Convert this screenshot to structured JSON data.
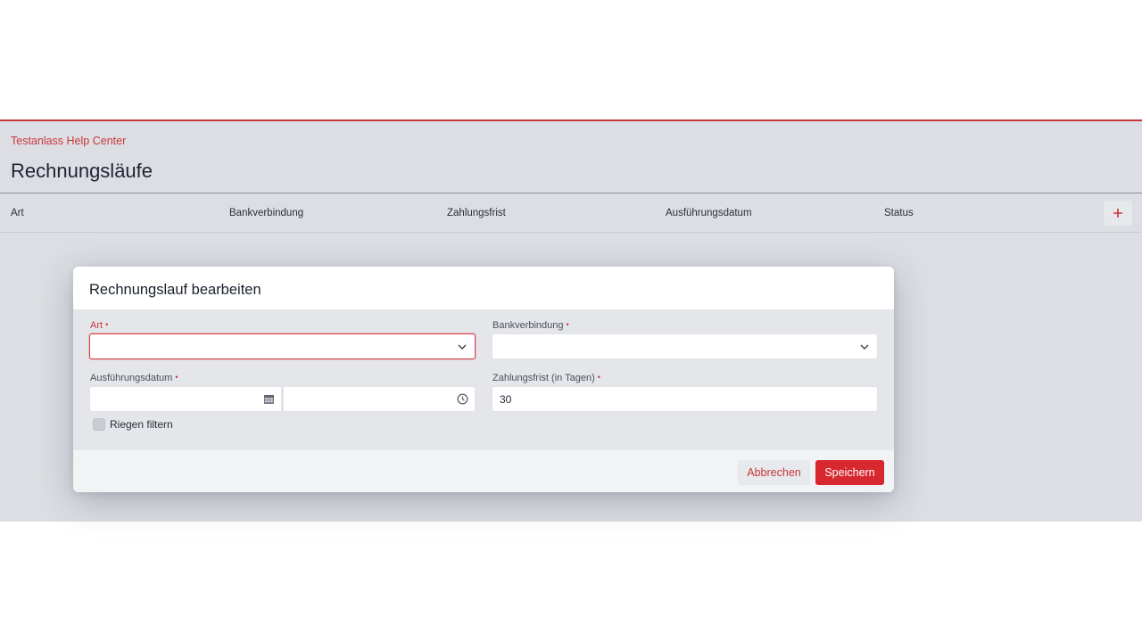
{
  "breadcrumb": "Testanlass Help Center",
  "page_title": "Rechnungsläufe",
  "table": {
    "columns": [
      "Art",
      "Bankverbindung",
      "Zahlungsfrist",
      "Ausführungsdatum",
      "Status"
    ],
    "add_icon": "plus-icon"
  },
  "modal": {
    "title": "Rechnungslauf bearbeiten",
    "fields": {
      "art": {
        "label": "Art",
        "required": "•",
        "value": ""
      },
      "bankverbindung": {
        "label": "Bankverbindung",
        "required": "•",
        "value": ""
      },
      "ausfuehrungsdatum": {
        "label": "Ausführungsdatum",
        "required": "•",
        "date_value": "",
        "time_value": ""
      },
      "zahlungsfrist": {
        "label": "Zahlungsfrist (in Tagen)",
        "required": "•",
        "value": "30"
      }
    },
    "checkbox": {
      "label": "Riegen filtern",
      "checked": false
    },
    "buttons": {
      "cancel": "Abbrechen",
      "save": "Speichern"
    }
  },
  "colors": {
    "accent": "#c8363d",
    "primary_button": "#d7282f",
    "backdrop": "#dcdee3"
  }
}
